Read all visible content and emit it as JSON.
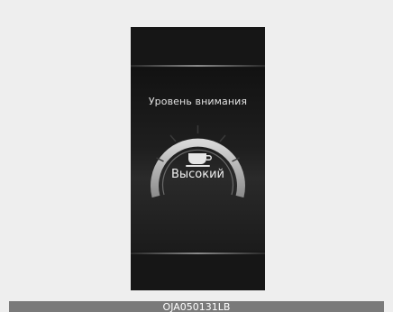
{
  "display": {
    "title": "Уровень внимания",
    "level_label": "Высокий",
    "icon": "coffee-cup-icon"
  },
  "image_code": "OJA050131LB",
  "colors": {
    "background": "#eeeeee",
    "screen": "#161616",
    "gauge_ring": "#b8b8b8",
    "caption_bar": "#7a7a7a"
  }
}
